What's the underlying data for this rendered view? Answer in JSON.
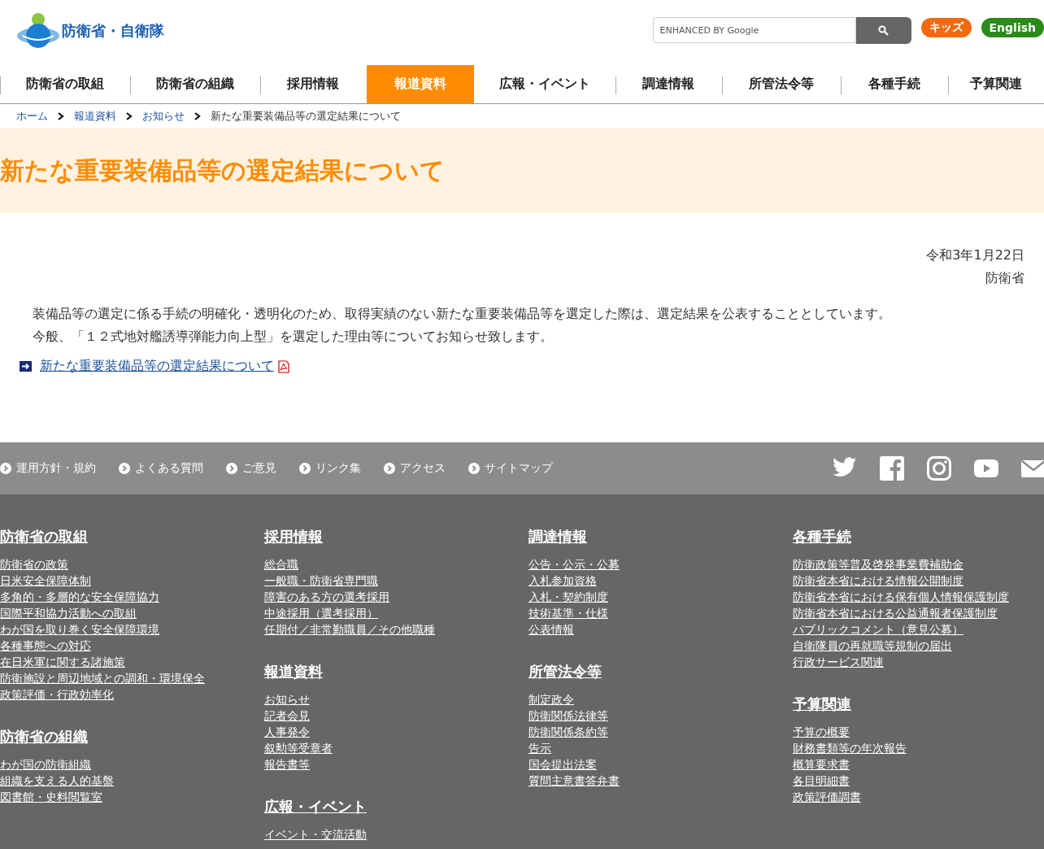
{
  "header": {
    "site_name": "防衛省・自衛隊",
    "search": {
      "placeholder": "ENHANCED BY Google"
    },
    "lang_buttons": [
      {
        "label": "キッズ",
        "color": "#f26a10"
      },
      {
        "label": "English",
        "color": "#2b8a1a"
      }
    ]
  },
  "nav": [
    {
      "label": "防衛省の取組",
      "selected": false
    },
    {
      "label": "防衛省の組織",
      "selected": false
    },
    {
      "label": "採用情報",
      "selected": false
    },
    {
      "label": "報道資料",
      "selected": true
    },
    {
      "label": "広報・イベント",
      "selected": false
    },
    {
      "label": "調達情報",
      "selected": false
    },
    {
      "label": "所管法令等",
      "selected": false
    },
    {
      "label": "各種手続",
      "selected": false
    },
    {
      "label": "予算関連",
      "selected": false
    }
  ],
  "breadcrumb": [
    "ホーム",
    "報道資料",
    "お知らせ",
    "新たな重要装備品等の選定結果について"
  ],
  "page_title": "新たな重要装備品等の選定結果について",
  "article": {
    "date": "令和3年1月22日",
    "author": "防衛省",
    "body_lines": [
      "装備品等の選定に係る手続の明確化・透明化のため、取得実績のない新たな重要装備品等を選定した際は、選定結果を公表することとしています。",
      "今般、「１２式地対艦誘導弾能力向上型」を選定した理由等についてお知らせ致します。"
    ],
    "link": "新たな重要装備品等の選定結果について"
  },
  "footer_links": [
    "運用方針・規約",
    "よくある質問",
    "ご意見",
    "リンク集",
    "アクセス",
    "サイトマップ"
  ],
  "sitemap": [
    [
      {
        "heading": "防衛省の取組",
        "links": [
          "防衛省の政策",
          "日米安全保障体制",
          "多角的・多層的な安全保障協力",
          "国際平和協力活動への取組",
          "わが国を取り巻く安全保障環境",
          "各種事態への対応",
          "在日米軍に関する諸施策",
          "防衛施設と周辺地域との調和・環境保全",
          "政策評価・行政効率化"
        ]
      },
      {
        "heading": "防衛省の組織",
        "links": [
          "わが国の防衛組織",
          "組織を支える人的基盤",
          "図書館・史料閲覧室"
        ]
      }
    ],
    [
      {
        "heading": "採用情報",
        "links": [
          "総合職",
          "一般職・防衛省専門職",
          "障害のある方の選考採用",
          "中途採用（選考採用）",
          "任期付／非常勤職員／その他職種"
        ]
      },
      {
        "heading": "報道資料",
        "links": [
          "お知らせ",
          "記者会見",
          "人事発令",
          "叙勲等受章者",
          "報告書等"
        ]
      },
      {
        "heading": "広報・イベント",
        "links": [
          "イベント・交流活動"
        ]
      }
    ],
    [
      {
        "heading": "調達情報",
        "links": [
          "公告・公示・公募",
          "入札参加資格",
          "入札・契約制度",
          "技術基準・仕様",
          "公表情報"
        ]
      },
      {
        "heading": "所管法令等",
        "links": [
          "制定政令",
          "防衛関係法律等",
          "防衛関係条約等",
          "告示",
          "国会提出法案",
          "質問主意書答弁書"
        ]
      }
    ],
    [
      {
        "heading": "各種手続",
        "links": [
          "防衛政策等普及啓発事業費補助金",
          "防衛省本省における情報公開制度",
          "防衛省本省における保有個人情報保護制度",
          "防衛省本省における公益通報者保護制度",
          "パブリックコメント（意見公募）",
          "自衛隊員の再就職等規制の届出",
          "行政サービス関連"
        ]
      },
      {
        "heading": "予算関連",
        "links": [
          "予算の概要",
          "財務書類等の年次報告",
          "概算要求書",
          "各目明細書",
          "政策評価調書"
        ]
      }
    ]
  ]
}
